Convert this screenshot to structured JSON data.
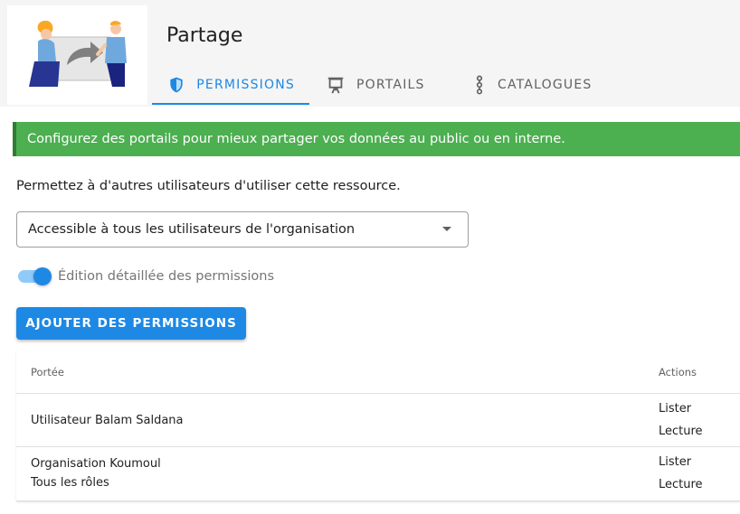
{
  "header": {
    "title": "Partage",
    "tabs": [
      {
        "label": "PERMISSIONS",
        "icon": "shield-icon",
        "active": true
      },
      {
        "label": "PORTAILS",
        "icon": "easel-icon",
        "active": false
      },
      {
        "label": "CATALOGUES",
        "icon": "dots-vertical-icon",
        "active": false
      }
    ]
  },
  "banner": {
    "text": "Configurez des portails pour mieux partager vos données au public ou en interne."
  },
  "intro": "Permettez à d'autres utilisateurs d'utiliser cette ressource.",
  "access_select": {
    "value": "Accessible à tous les utilisateurs de l'organisation"
  },
  "detailed_toggle": {
    "label": "Édition détaillée des permissions",
    "on": true
  },
  "add_button": {
    "label": "AJOUTER DES PERMISSIONS"
  },
  "table": {
    "headers": {
      "scope": "Portée",
      "actions": "Actions"
    },
    "rows": [
      {
        "scope_lines": [
          "Utilisateur Balam Saldana"
        ],
        "actions": [
          "Lister",
          "Lecture"
        ]
      },
      {
        "scope_lines": [
          "Organisation Koumoul",
          "Tous les rôles"
        ],
        "actions": [
          "Lister",
          "Lecture"
        ]
      }
    ]
  },
  "colors": {
    "primary": "#1e88e5",
    "success": "#4caf50",
    "success_dark": "#2e7d32",
    "header_bg": "#f5f5f5"
  }
}
